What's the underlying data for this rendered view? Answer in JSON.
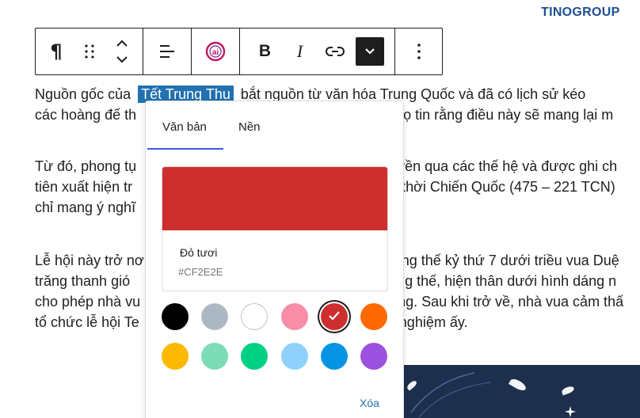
{
  "brand": {
    "logo_tino": "TINO",
    "logo_group": "GROUP"
  },
  "toolbar": {
    "paragraph_label": "¶",
    "bold_label": "B",
    "italic_label": "I",
    "ai_label": "ai"
  },
  "content": {
    "p1": {
      "before": "Nguồn gốc của",
      "highlight": "Tết Trung Thu",
      "after": "bắt nguồn từ văn hóa Trung Quốc và đã có lịch sử kéo",
      "line2_left": "các hoàng đế th",
      "line2_right": "họ tin rằng điều này sẽ mang lại m"
    },
    "p2": {
      "line1_left": "Từ đó, phong tụ",
      "line1_right": "yền qua các thế hệ và được ghi ch",
      "line2_left": "tiên xuất hiện tr",
      "line2_right": "o thời Chiến Quốc (475 – 221 TCN)",
      "line3_left": "chỉ mang ý nghĩ"
    },
    "p3": {
      "line1_left": "Lễ hội này trở nơ",
      "line1_right": "ng thế kỷ thứ 7 dưới triều vua Duệ",
      "line2_left": "trăng thanh gió",
      "line2_right": "áng thế, hiện thân dưới hình dáng n",
      "line3_left": "cho phép nhà vu",
      "line3_right": "ng. Sau khi trở về, nhà vua cảm thấ",
      "line4_left": "tổ chức lễ hội Te",
      "line4_right": "nghiệm ấy."
    }
  },
  "popover": {
    "tabs": [
      {
        "label": "Văn bản"
      },
      {
        "label": "Nền"
      }
    ],
    "selected_color": {
      "name": "Đỏ tươi",
      "hex": "#CF2E2E"
    },
    "palette": [
      {
        "color": "#000000",
        "icon": "swatch-black"
      },
      {
        "color": "#abb8c3",
        "icon": "swatch-gray"
      },
      {
        "color": "#ffffff",
        "icon": "swatch-white"
      },
      {
        "color": "#f78da7",
        "icon": "swatch-pink"
      },
      {
        "color": "#cf2e2e",
        "icon": "swatch-red",
        "selected": true
      },
      {
        "color": "#ff6900",
        "icon": "swatch-orange"
      },
      {
        "color": "#fcb900",
        "icon": "swatch-amber"
      },
      {
        "color": "#7bdcb5",
        "icon": "swatch-light-green"
      },
      {
        "color": "#00d084",
        "icon": "swatch-green"
      },
      {
        "color": "#8ed1fc",
        "icon": "swatch-light-blue"
      },
      {
        "color": "#0693e3",
        "icon": "swatch-blue"
      },
      {
        "color": "#9b51e0",
        "icon": "swatch-purple"
      }
    ],
    "clear_label": "Xóa"
  }
}
